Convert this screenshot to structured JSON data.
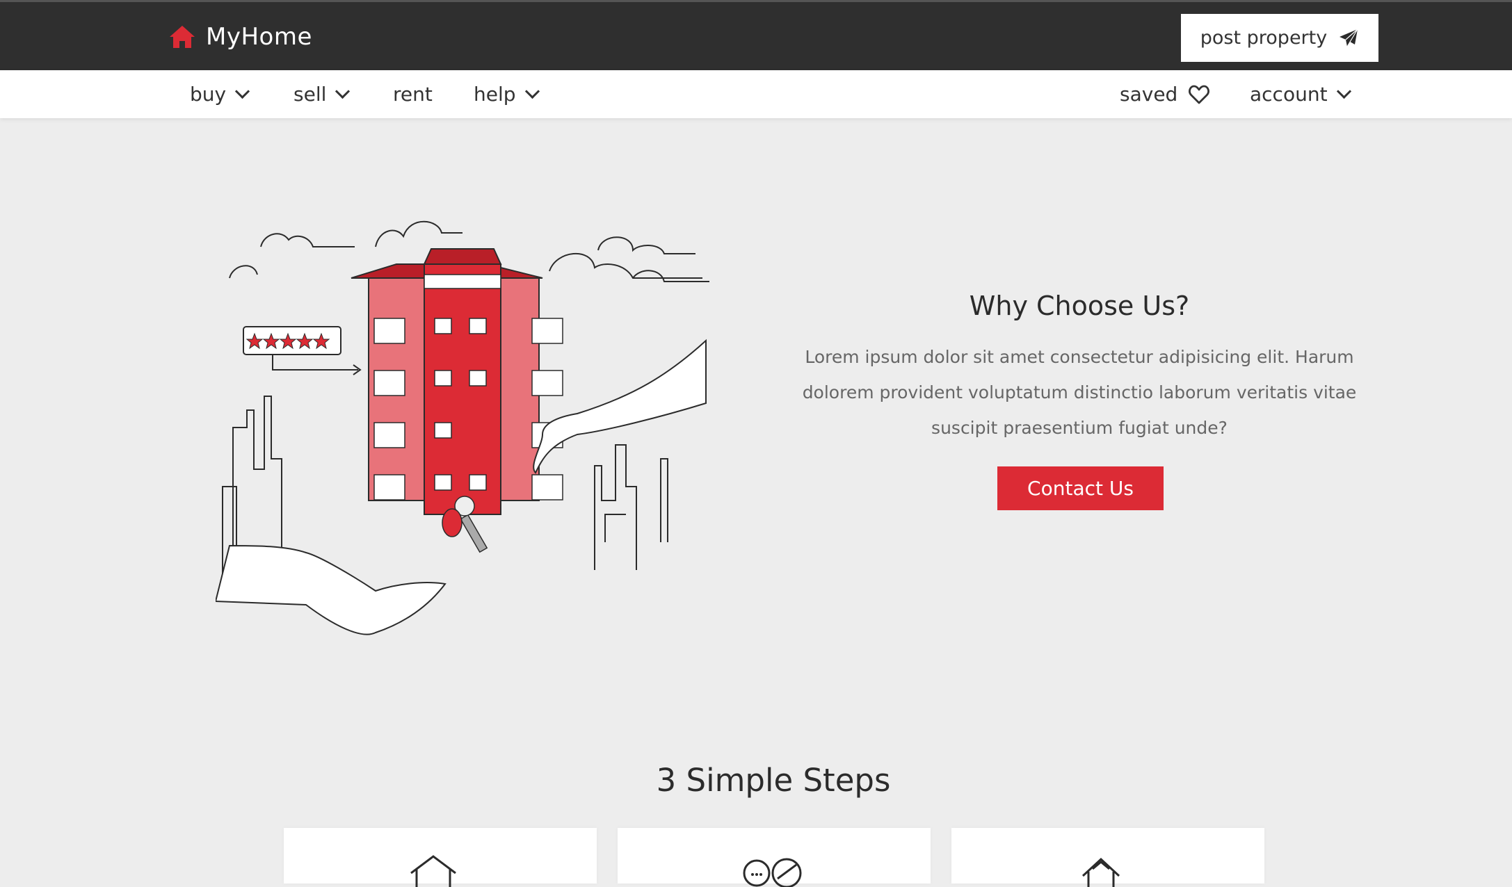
{
  "header": {
    "brand": "MyHome",
    "post_property_label": "post property"
  },
  "nav": {
    "left": [
      {
        "label": "buy",
        "dropdown": true
      },
      {
        "label": "sell",
        "dropdown": true
      },
      {
        "label": "rent",
        "dropdown": false
      },
      {
        "label": "help",
        "dropdown": true
      }
    ],
    "right": [
      {
        "label": "saved",
        "icon": "heart-icon"
      },
      {
        "label": "account",
        "dropdown": true
      }
    ]
  },
  "hero": {
    "rating_stars": 5,
    "title": "Why Choose Us?",
    "text": "Lorem ipsum dolor sit amet consectetur adipisicing elit. Harum dolorem provident voluptatum distinctio laborum veritatis vitae suscipit praesentium fugiat unde?",
    "button_label": "Contact Us"
  },
  "steps": {
    "title": "3 Simple Steps",
    "cards": [
      {
        "icon": "house-search-icon"
      },
      {
        "icon": "chat-icon"
      },
      {
        "icon": "house-icon"
      }
    ]
  },
  "colors": {
    "accent": "#dc2b35",
    "topbar": "#2f2f2f",
    "background": "#ededed"
  }
}
